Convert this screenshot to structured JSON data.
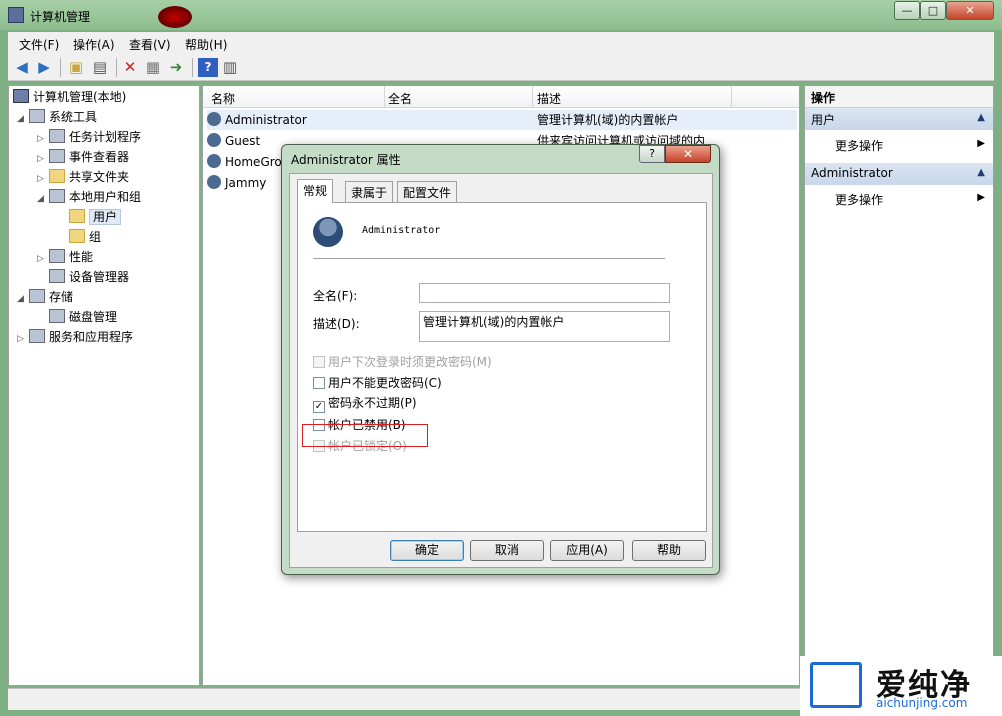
{
  "window": {
    "title": "计算机管理",
    "minimize": "—",
    "maximize": "□",
    "close": "✕"
  },
  "menu": [
    "文件(F)",
    "操作(A)",
    "查看(V)",
    "帮助(H)"
  ],
  "tree": {
    "root": "计算机管理(本地)",
    "system_tools": "系统工具",
    "task_scheduler": "任务计划程序",
    "event_viewer": "事件查看器",
    "shared_folders": "共享文件夹",
    "local_users": "本地用户和组",
    "users": "用户",
    "groups": "组",
    "performance": "性能",
    "device_manager": "设备管理器",
    "storage": "存储",
    "disk_management": "磁盘管理",
    "services_apps": "服务和应用程序"
  },
  "list": {
    "columns": [
      "名称",
      "全名",
      "描述"
    ],
    "rows": [
      {
        "name": "Administrator",
        "fullname": "",
        "desc": "管理计算机(域)的内置帐户"
      },
      {
        "name": "Guest",
        "fullname": "",
        "desc": "供来宾访问计算机或访问域的内"
      },
      {
        "name": "HomeGro",
        "fullname": "",
        "desc": ""
      },
      {
        "name": "Jammy",
        "fullname": "",
        "desc": ""
      }
    ]
  },
  "actions": {
    "title": "操作",
    "section1": "用户",
    "section1_item": "更多操作",
    "section2": "Administrator",
    "section2_item": "更多操作"
  },
  "dialog": {
    "title": "Administrator 属性",
    "help": "?",
    "close": "✕",
    "tabs": [
      "常规",
      "隶属于",
      "配置文件"
    ],
    "username": "Administrator",
    "fullname_label": "全名(F):",
    "fullname_value": "",
    "desc_label": "描述(D):",
    "desc_value": "管理计算机(域)的内置帐户",
    "checkboxes": [
      {
        "label": "用户下次登录时须更改密码(M)",
        "checked": false,
        "disabled": true
      },
      {
        "label": "用户不能更改密码(C)",
        "checked": false,
        "disabled": false
      },
      {
        "label": "密码永不过期(P)",
        "checked": true,
        "disabled": false
      },
      {
        "label": "帐户已禁用(B)",
        "checked": false,
        "disabled": false
      },
      {
        "label": "帐户已锁定(O)",
        "checked": false,
        "disabled": true
      }
    ],
    "buttons": {
      "ok": "确定",
      "cancel": "取消",
      "apply": "应用(A)",
      "help": "帮助"
    }
  },
  "watermark": {
    "text": "爱纯净",
    "url": "aichunjing.com"
  },
  "colors": {
    "highlight_border": "#d81f1f",
    "selection": "#dfe8f3"
  }
}
